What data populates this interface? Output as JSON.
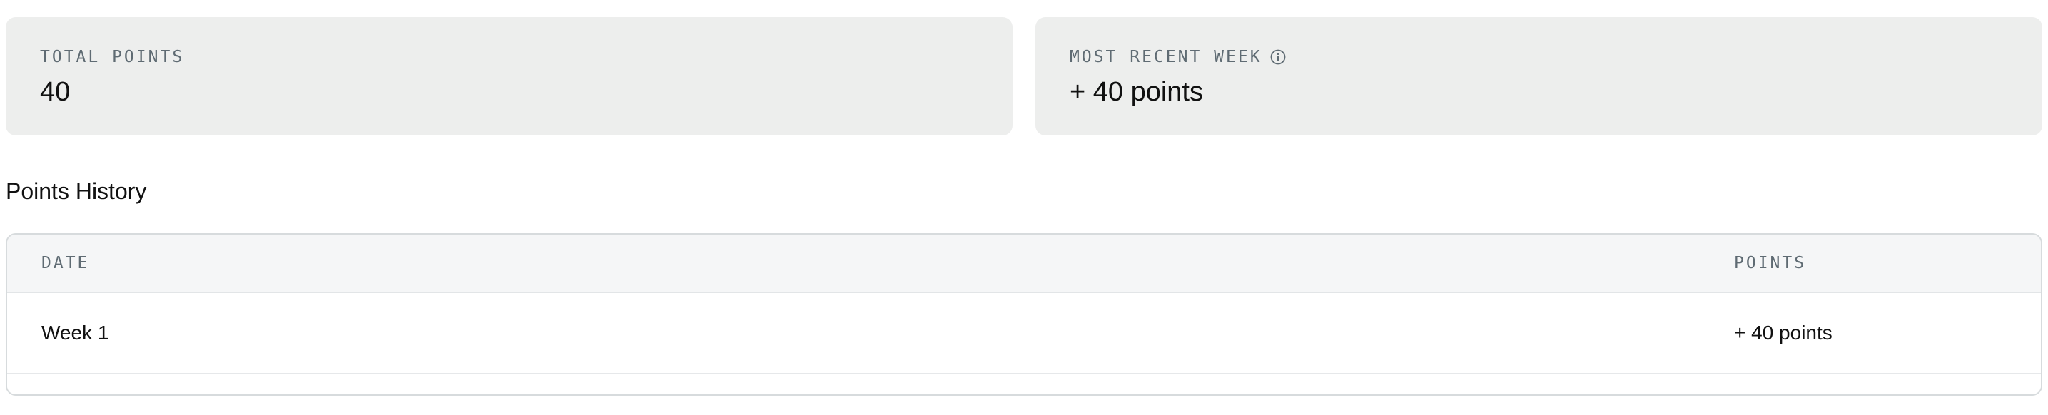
{
  "stats": {
    "total_points": {
      "label": "TOTAL POINTS",
      "value": "40"
    },
    "most_recent_week": {
      "label": "MOST RECENT WEEK",
      "icon": "info-icon",
      "value": "+ 40 points"
    }
  },
  "history": {
    "title": "Points History",
    "columns": {
      "date": "DATE",
      "points": "POINTS"
    },
    "rows": [
      {
        "date": "Week 1",
        "points": "+ 40 points"
      }
    ]
  },
  "colors": {
    "card_background": "#edeeed",
    "label_text": "#5f6b73",
    "table_header_background": "#f5f6f7",
    "border": "#d7dbdd"
  }
}
